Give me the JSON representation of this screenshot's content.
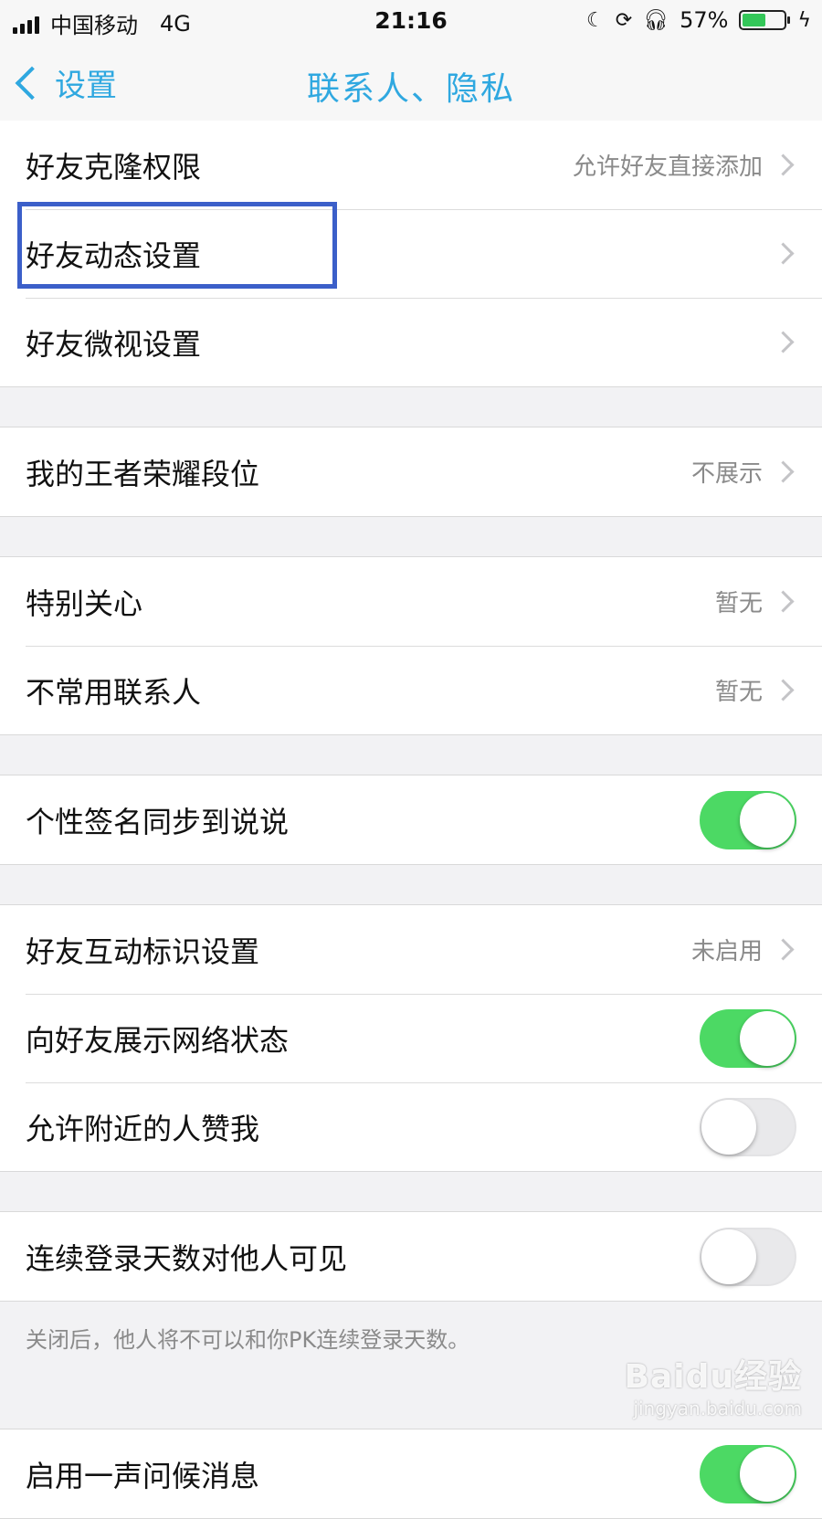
{
  "status_bar": {
    "carrier": "中国移动",
    "network": "4G",
    "time": "21:16",
    "battery_percent": "57%",
    "battery_level": 0.57,
    "icons": [
      "moon-icon",
      "rotation-lock-icon",
      "headphones-icon",
      "charging-icon"
    ]
  },
  "nav": {
    "back_label": "设置",
    "title": "联系人、隐私"
  },
  "groups": [
    {
      "rows": [
        {
          "label": "好友克隆权限",
          "value": "允许好友直接添加",
          "type": "disclosure"
        },
        {
          "label": "好友动态设置",
          "value": "",
          "type": "disclosure"
        },
        {
          "label": "好友微视设置",
          "value": "",
          "type": "disclosure"
        }
      ]
    },
    {
      "rows": [
        {
          "label": "我的王者荣耀段位",
          "value": "不展示",
          "type": "disclosure"
        }
      ]
    },
    {
      "rows": [
        {
          "label": "特别关心",
          "value": "暂无",
          "type": "disclosure"
        },
        {
          "label": "不常用联系人",
          "value": "暂无",
          "type": "disclosure"
        }
      ]
    },
    {
      "rows": [
        {
          "label": "个性签名同步到说说",
          "type": "toggle",
          "on": true
        }
      ]
    },
    {
      "rows": [
        {
          "label": "好友互动标识设置",
          "value": "未启用",
          "type": "disclosure"
        },
        {
          "label": "向好友展示网络状态",
          "type": "toggle",
          "on": true
        },
        {
          "label": "允许附近的人赞我",
          "type": "toggle",
          "on": false
        }
      ]
    },
    {
      "rows": [
        {
          "label": "连续登录天数对他人可见",
          "type": "toggle",
          "on": false
        }
      ],
      "footer": "关闭后，他人将不可以和你PK连续登录天数。"
    },
    {
      "rows": [
        {
          "label": "启用一声问候消息",
          "type": "toggle",
          "on": true
        }
      ]
    }
  ],
  "watermark": {
    "main": "Baidu经验",
    "sub": "jingyan.baidu.com"
  },
  "colors": {
    "accent": "#2fa8e0",
    "toggle_on": "#4cd964",
    "highlight": "#3b5fc9"
  }
}
